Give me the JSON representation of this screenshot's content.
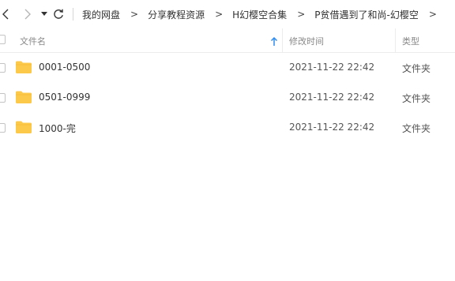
{
  "toolbar": {
    "back_icon": "chevron-left-icon",
    "forward_icon": "chevron-right-icon",
    "dropdown_icon": "caret-down-icon",
    "refresh_icon": "refresh-icon",
    "breadcrumb": [
      "我的网盘",
      "分享教程资源",
      "H幻樱空合集",
      "P贫借遇到了和尚-幻樱空"
    ],
    "separator": ">"
  },
  "header": {
    "name": "文件名",
    "modified": "修改时间",
    "type": "类型",
    "sort_icon": "arrow-up-icon"
  },
  "rows": [
    {
      "name": "0001-0500",
      "modified": "2021-11-22 22:42",
      "type": "文件夹",
      "icon": "folder-icon"
    },
    {
      "name": "0501-0999",
      "modified": "2021-11-22 22:42",
      "type": "文件夹",
      "icon": "folder-icon"
    },
    {
      "name": "1000-完",
      "modified": "2021-11-22 22:42",
      "type": "文件夹",
      "icon": "folder-icon"
    }
  ],
  "colors": {
    "folder": "#fdc94b",
    "sort_arrow": "#2e8bf0"
  }
}
